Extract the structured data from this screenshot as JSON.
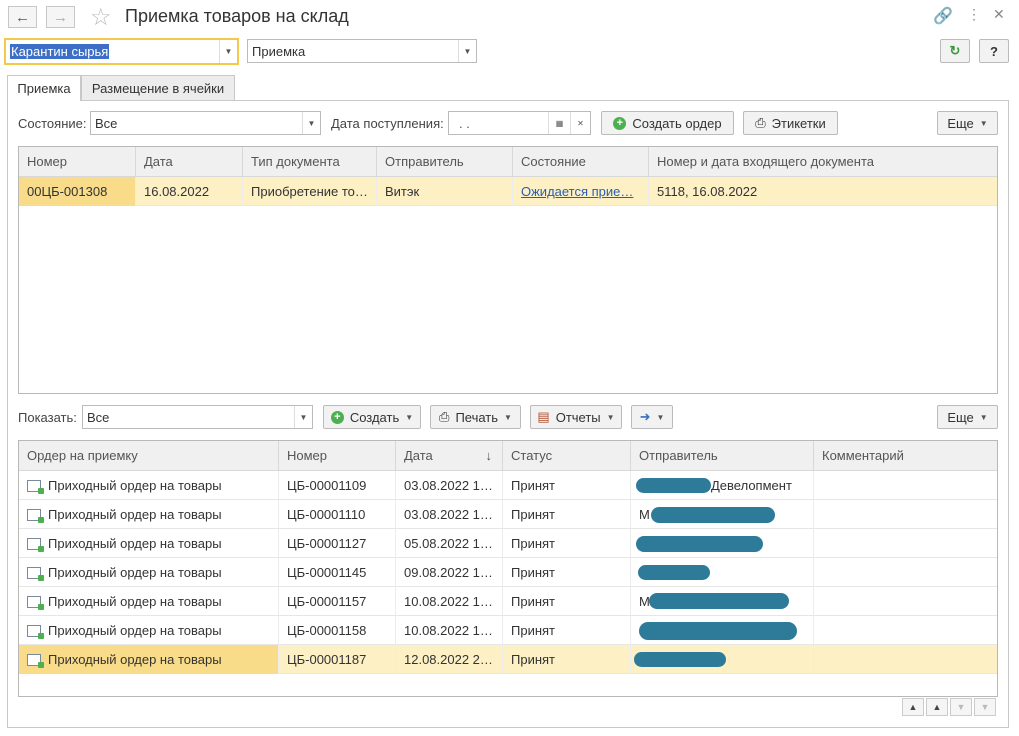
{
  "window": {
    "title": "Приемка товаров на склад"
  },
  "header": {
    "warehouse": "Карантин сырья",
    "mode": "Приемка",
    "refresh_label": "C",
    "help_label": "?"
  },
  "tabs": [
    {
      "label": "Приемка",
      "active": true
    },
    {
      "label": "Размещение в ячейки",
      "active": false
    }
  ],
  "filters": {
    "state_label": "Состояние:",
    "state_value": "Все",
    "date_label": "Дата поступления:",
    "date_value": " .  .",
    "create_order_label": "Создать ордер",
    "labels_label": "Этикетки",
    "more_label": "Еще"
  },
  "top_table": {
    "columns": [
      "Номер",
      "Дата",
      "Тип документа",
      "Отправитель",
      "Состояние",
      "Номер и дата входящего документа"
    ],
    "rows": [
      {
        "number": "00ЦБ-001308",
        "date": "16.08.2022",
        "doc_type": "Приобретение то…",
        "sender": "Витэк",
        "state": "Ожидается прие…",
        "incoming": "5118, 16.08.2022"
      }
    ]
  },
  "bottom_toolbar": {
    "show_label": "Показать:",
    "show_value": "Все",
    "create_label": "Создать",
    "print_label": "Печать",
    "reports_label": "Отчеты",
    "more_label": "Еще"
  },
  "bottom_table": {
    "columns": [
      "Ордер на приемку",
      "Номер",
      "Дата",
      "Статус",
      "Отправитель",
      "Комментарий"
    ],
    "sort_indicator": "↓",
    "rows": [
      {
        "order": "Приходный ордер на товары",
        "number": "ЦБ-00001109",
        "date": "03.08.2022 1…",
        "status": "Принят",
        "sender": "Девелопмент",
        "comment": ""
      },
      {
        "order": "Приходный ордер на товары",
        "number": "ЦБ-00001110",
        "date": "03.08.2022 1…",
        "status": "Принят",
        "sender": "М",
        "comment": ""
      },
      {
        "order": "Приходный ордер на товары",
        "number": "ЦБ-00001127",
        "date": "05.08.2022 1…",
        "status": "Принят",
        "sender": "",
        "comment": ""
      },
      {
        "order": "Приходный ордер на товары",
        "number": "ЦБ-00001145",
        "date": "09.08.2022 1…",
        "status": "Принят",
        "sender": "",
        "comment": ""
      },
      {
        "order": "Приходный ордер на товары",
        "number": "ЦБ-00001157",
        "date": "10.08.2022 1…",
        "status": "Принят",
        "sender": "М",
        "comment": ""
      },
      {
        "order": "Приходный ордер на товары",
        "number": "ЦБ-00001158",
        "date": "10.08.2022 1…",
        "status": "Принят",
        "sender": "",
        "comment": ""
      },
      {
        "order": "Приходный ордер на товары",
        "number": "ЦБ-00001187",
        "date": "12.08.2022 2…",
        "status": "Принят",
        "sender": "",
        "comment": ""
      }
    ]
  },
  "colors": {
    "selected_row": "#fcf0c4",
    "current_cell": "#f9dc8a",
    "focus_border": "#f2c94c",
    "link": "#2a5db0",
    "redaction": "#2e7a99"
  }
}
